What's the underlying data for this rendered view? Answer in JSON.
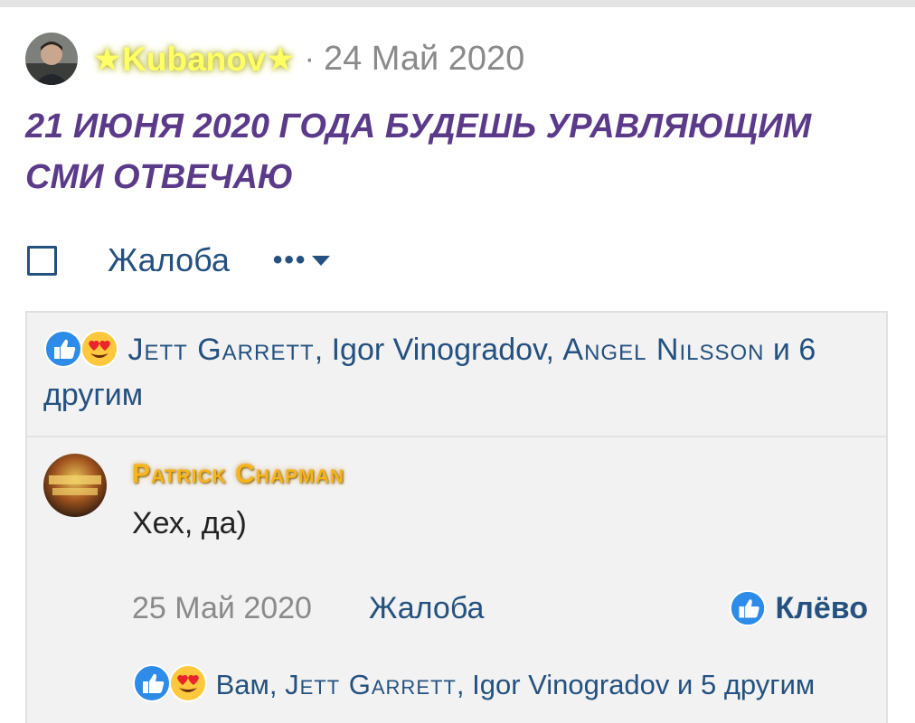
{
  "post": {
    "author": "★Kubanov★",
    "separator": "·",
    "date": "24 Май 2020",
    "text": "21 ИЮНЯ 2020 ГОДА БУДЕШЬ УРАВЛЯЮЩИМ СМИ ОТВЕЧАЮ",
    "actions": {
      "report_label": "Жалоба",
      "more_label": "•••"
    }
  },
  "reactions": {
    "icons": [
      "like-icon",
      "love-eyes-icon"
    ],
    "user1": "Jett Garrett",
    "sep1": ", ",
    "user2": "Igor Vinogradov",
    "sep2": ", ",
    "user3": "Angel Nilsson",
    "tail": " и 6 другим"
  },
  "reply": {
    "author": "Patrick Chapman",
    "text": "Хех, да)",
    "date": "25 Май 2020",
    "report_label": "Жалоба",
    "like_label": "Клёво",
    "reactions": {
      "lead": "Вам, ",
      "user1": "Jett Garrett",
      "sep1": ", ",
      "user2": "Igor Vinogradov",
      "tail": " и 5 другим"
    }
  },
  "colors": {
    "link": "#24517f",
    "post_text": "#5b3a8a",
    "author_glow": "#ffff66",
    "reply_author": "#f7b51a",
    "muted": "#8a8a8a",
    "panel_bg": "#f2f2f2"
  }
}
